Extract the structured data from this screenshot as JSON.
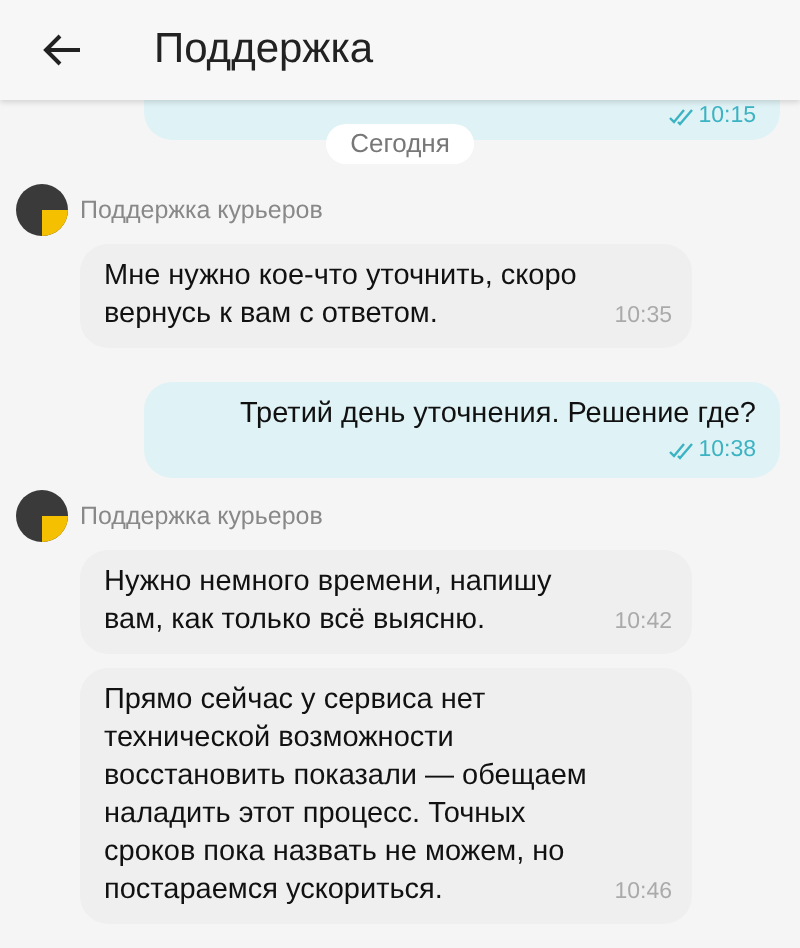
{
  "header": {
    "title": "Поддержка"
  },
  "messages": [
    {
      "kind": "out_partial",
      "time": "10:15",
      "read": true
    },
    {
      "kind": "date",
      "text": "Сегодня"
    },
    {
      "kind": "sender",
      "text": "Поддержка курьеров"
    },
    {
      "kind": "in",
      "text": "Мне нужно кое-что уточнить, скоро вернусь к вам с ответом.",
      "time": "10:35"
    },
    {
      "kind": "out",
      "text": "Третий день уточнения. Решение где?",
      "time": "10:38",
      "read": true
    },
    {
      "kind": "sender",
      "text": "Поддержка курьеров"
    },
    {
      "kind": "in",
      "text": "Нужно немного времени, напишу вам, как только всё выясню.",
      "time": "10:42"
    },
    {
      "kind": "in",
      "text": "Прямо сейчас у сервиса нет технической возможности восстановить показали — обещаем наладить этот процесс. Точных сроков пока назвать не можем, но постараемся ускориться.",
      "time": "10:46"
    }
  ]
}
